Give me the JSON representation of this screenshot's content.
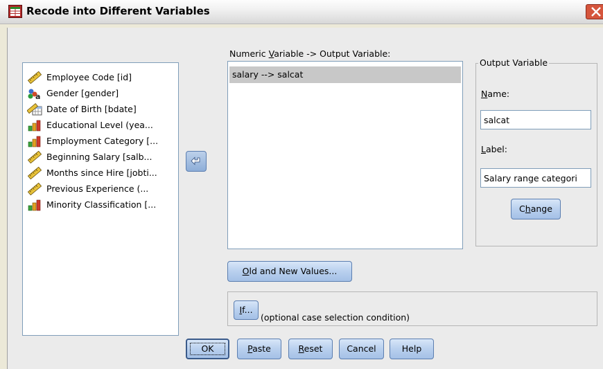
{
  "window": {
    "title": "Recode into Different Variables"
  },
  "variables": [
    {
      "label": "Employee Code [id]",
      "icon": "scale-ruler-icon"
    },
    {
      "label": "Gender [gender]",
      "icon": "nominal-string-icon"
    },
    {
      "label": "Date of Birth [bdate]",
      "icon": "date-scale-icon"
    },
    {
      "label": "Educational Level (yea...",
      "icon": "ordinal-bar-icon"
    },
    {
      "label": "Employment Category [...",
      "icon": "ordinal-bar-icon"
    },
    {
      "label": "Beginning Salary [salb...",
      "icon": "scale-ruler-icon"
    },
    {
      "label": "Months since Hire [jobti...",
      "icon": "scale-ruler-icon"
    },
    {
      "label": "Previous Experience (...",
      "icon": "scale-ruler-icon"
    },
    {
      "label": "Minority Classification [...",
      "icon": "ordinal-bar-icon"
    }
  ],
  "mapping": {
    "header": "Numeric Variable -> Output Variable:",
    "header_pre": "Numeric ",
    "header_ul": "V",
    "header_post": "ariable -> Output Variable:",
    "items": [
      "salary --> salcat"
    ]
  },
  "output_variable": {
    "legend": "Output Variable",
    "name_ul": "N",
    "name_rest": "ame:",
    "name_value": "salcat",
    "label_ul": "L",
    "label_rest": "abel:",
    "label_value": "Salary range categori",
    "change_pre": "C",
    "change_ul": "h",
    "change_post": "ange"
  },
  "old_new": {
    "ul": "O",
    "rest": "ld and New Values..."
  },
  "if_section": {
    "button_ul": "I",
    "button_rest": "f...",
    "description": "(optional case selection condition)"
  },
  "footer": {
    "ok": "OK",
    "paste_ul": "P",
    "paste_rest": "aste",
    "reset_ul": "R",
    "reset_rest": "eset",
    "cancel": "Cancel",
    "help": "Help"
  },
  "colors": {
    "accent": "#a4c0e6",
    "close": "#d5553c"
  }
}
